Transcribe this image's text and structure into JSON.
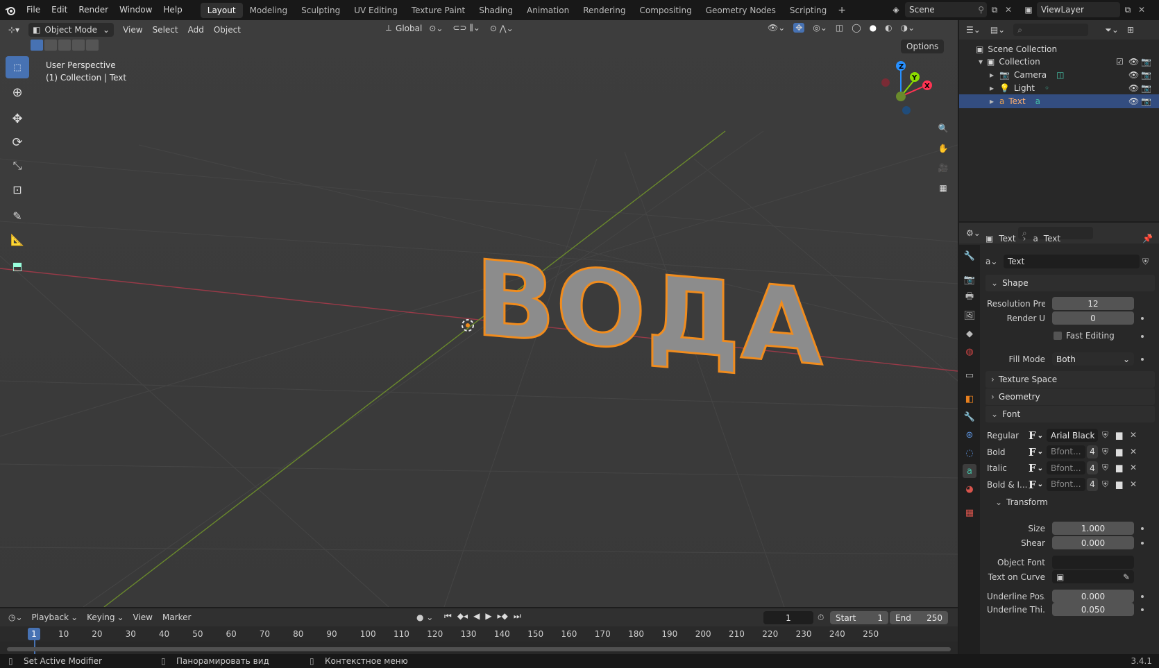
{
  "topbar": {
    "menus": [
      "File",
      "Edit",
      "Render",
      "Window",
      "Help"
    ],
    "workspaces": [
      "Layout",
      "Modeling",
      "Sculpting",
      "UV Editing",
      "Texture Paint",
      "Shading",
      "Animation",
      "Rendering",
      "Compositing",
      "Geometry Nodes",
      "Scripting"
    ],
    "active_workspace": "Layout",
    "add_tab": "+",
    "scene": "Scene",
    "view_layer": "ViewLayer"
  },
  "viewport": {
    "mode": "Object Mode",
    "menus": [
      "View",
      "Select",
      "Add",
      "Object"
    ],
    "orientation": "Global",
    "options": "Options",
    "overlay_title": "User Perspective",
    "overlay_subtitle": "(1) Collection | Text",
    "text_object": "ВОДА",
    "gizmo": {
      "x": "X",
      "y": "Y",
      "z": "Z"
    }
  },
  "outliner": {
    "root": "Scene Collection",
    "collection": "Collection",
    "items": [
      {
        "name": "Camera",
        "selected": false
      },
      {
        "name": "Light",
        "selected": false
      },
      {
        "name": "Text",
        "selected": true
      }
    ]
  },
  "properties": {
    "breadcrumb_object": "Text",
    "breadcrumb_data": "Text",
    "datablock": "Text",
    "shape": {
      "header": "Shape",
      "resolution_label": "Resolution Pre...",
      "resolution_value": "12",
      "render_u_label": "Render U",
      "render_u_value": "0",
      "fast_editing": "Fast Editing",
      "fill_mode_label": "Fill Mode",
      "fill_mode_value": "Both"
    },
    "texture_space": "Texture Space",
    "geometry": "Geometry",
    "font": {
      "header": "Font",
      "rows": [
        {
          "label": "Regular",
          "value": "Arial Black",
          "users": ""
        },
        {
          "label": "Bold",
          "value": "Bfont...",
          "users": "4"
        },
        {
          "label": "Italic",
          "value": "Bfont...",
          "users": "4"
        },
        {
          "label": "Bold & I...",
          "value": "Bfont...",
          "users": "4"
        }
      ],
      "font_glyph": "F"
    },
    "transform": {
      "header": "Transform",
      "size_label": "Size",
      "size_value": "1.000",
      "shear_label": "Shear",
      "shear_value": "0.000",
      "object_font_label": "Object Font",
      "text_on_curve_label": "Text on Curve",
      "underline_pos_label": "Underline Pos...",
      "underline_pos_value": "0.000",
      "underline_thi_label": "Underline Thi...",
      "underline_thi_value": "0.050"
    }
  },
  "timeline": {
    "menus": [
      "Playback",
      "Keying",
      "View",
      "Marker"
    ],
    "current_frame": "1",
    "start_label": "Start",
    "start_value": "1",
    "end_label": "End",
    "end_value": "250",
    "ticks": [
      "10",
      "20",
      "30",
      "40",
      "50",
      "60",
      "70",
      "80",
      "90",
      "100",
      "110",
      "120",
      "130",
      "140",
      "150",
      "160",
      "170",
      "180",
      "190",
      "200",
      "210",
      "220",
      "230",
      "240",
      "250"
    ],
    "playhead": "1"
  },
  "statusbar": {
    "left": "Set Active Modifier",
    "middle": "Панорамировать вид",
    "right": "Контекстное меню",
    "version": "3.4.1"
  },
  "colors": {
    "accent": "#4772b3",
    "selection": "#334d80",
    "outline": "#f08c1e",
    "x_axis": "#ff3352",
    "y_axis": "#8bdc00",
    "z_axis": "#2890ff"
  }
}
